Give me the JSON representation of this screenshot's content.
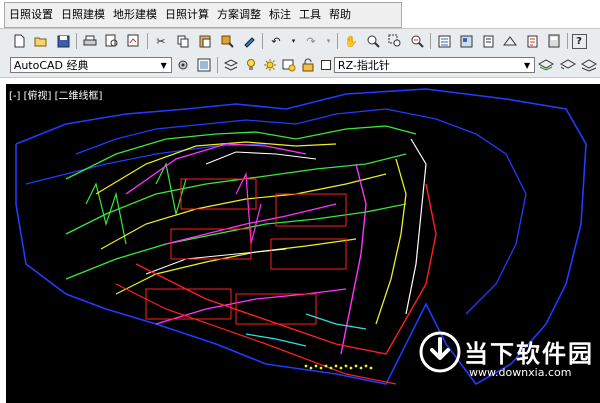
{
  "menu": [
    "日照设置",
    "日照建模",
    "地形建模",
    "日照计算",
    "方案调整",
    "标注",
    "工具",
    "帮助"
  ],
  "toolbar_icons": [
    "new-file-icon",
    "open-folder-icon",
    "save-icon",
    "print-icon",
    "print-preview-icon",
    "plot-icon",
    "cut-icon",
    "copy-icon",
    "paste-icon",
    "match-properties-icon",
    "paint-brush-icon",
    "undo-icon",
    "redo-icon",
    "pan-hand-icon",
    "zoom-realtime-icon",
    "zoom-window-icon",
    "zoom-previous-icon",
    "properties-icon",
    "design-center-icon",
    "tool-palettes-icon",
    "sheet-set-icon",
    "markup-icon",
    "calculator-icon",
    "help-icon"
  ],
  "workspace": {
    "value": "AutoCAD 经典"
  },
  "layer": {
    "value": "RZ-指北针"
  },
  "viewport": {
    "label": "[-] [俯视] [二维线框]"
  },
  "watermark": {
    "brand": "当下软件园",
    "url": "www.downxia.com"
  },
  "colors": {
    "blue": "#1f3cff",
    "green": "#38e838",
    "yellow": "#f0f020",
    "magenta": "#ff33ff",
    "red": "#ff2020",
    "white": "#ffffff",
    "cyan": "#30e0e0"
  }
}
